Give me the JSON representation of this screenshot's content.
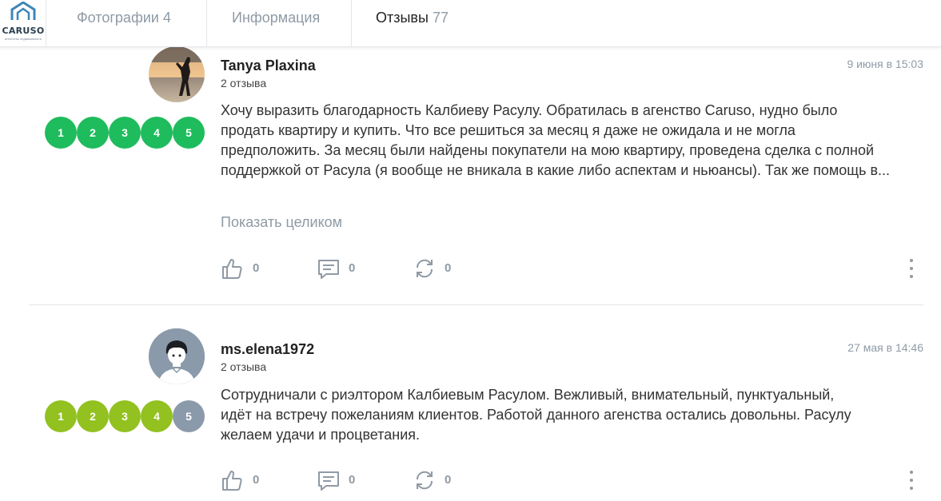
{
  "brand": {
    "name": "CARUSO",
    "tagline": "агентство недвижимости",
    "accent": "#2b6e99"
  },
  "tabs": [
    {
      "label": "Фотографии",
      "count": "4"
    },
    {
      "label": "Информация",
      "count": ""
    },
    {
      "label": "Отзывы",
      "count": "77",
      "active": true
    }
  ],
  "reviews": [
    {
      "author": "Tanya Plaxina",
      "reviews_count": "2 отзыва",
      "date": "9 июня в 15:03",
      "rating": 5,
      "rating_color": "#1ebc5c",
      "text": "Хочу выразить благодарность Калбиеву Расулу. Обратилась в агенство Caruso, нудно было продать квартиру и купить. Что все решиться за месяц я даже не ожидала и не могла предположить. За месяц были найдены покупатели на мою квартиру, проведена сделка с полной поддержкой от Расула (я вообще не вникала в какие либо аспектам и ньюансы). Так же помощь в...",
      "show_more": "Показать целиком",
      "likes": "0",
      "comments": "0",
      "reposts": "0",
      "rating_labels": [
        "1",
        "2",
        "3",
        "4",
        "5"
      ]
    },
    {
      "author": "ms.elena1972",
      "reviews_count": "2 отзыва",
      "date": "27 мая в 14:46",
      "rating": 4,
      "rating_color": "#92c120",
      "text": "Сотрудничали с риэлтором Калбиевым Расулом. Вежливый, внимательный, пунктуальный, идёт на встречу пожеланиям клиентов. Работой данного агенства остались довольны. Расулу желаем удачи и процветания.",
      "likes": "0",
      "comments": "0",
      "reposts": "0",
      "rating_labels": [
        "1",
        "2",
        "3",
        "4",
        "5"
      ]
    }
  ],
  "colors": {
    "inactive_dot": "#8a9aab",
    "muted": "#8f9aa5"
  }
}
